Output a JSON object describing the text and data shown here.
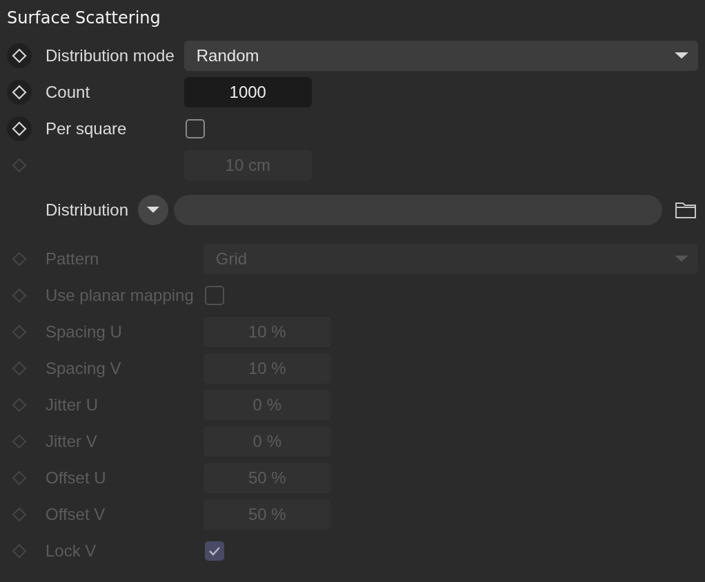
{
  "title": "Surface Scattering",
  "sections": [
    {
      "rows": [
        {
          "kind": "dropdown",
          "keyframe": true,
          "disabled": false,
          "label": "Distribution mode",
          "value": "Random"
        },
        {
          "kind": "number",
          "keyframe": true,
          "disabled": false,
          "label": "Count",
          "value": "1000"
        },
        {
          "kind": "checkbox",
          "keyframe": true,
          "disabled": false,
          "label": "Per square",
          "checked": false
        },
        {
          "kind": "number",
          "keyframe": true,
          "disabled": true,
          "value": "10 cm"
        }
      ]
    },
    {
      "rows": [
        {
          "kind": "link",
          "keyframe": false,
          "disabled": false,
          "label": "Distribution"
        }
      ]
    },
    {
      "rows": [
        {
          "kind": "dropdown",
          "keyframe": true,
          "disabled": true,
          "label": "Pattern",
          "value": "Grid"
        },
        {
          "kind": "checkbox",
          "keyframe": true,
          "disabled": true,
          "label": "Use planar mapping",
          "checked": false
        },
        {
          "kind": "number",
          "keyframe": true,
          "disabled": true,
          "label": "Spacing U",
          "value": "10 %"
        },
        {
          "kind": "number",
          "keyframe": true,
          "disabled": true,
          "label": "Spacing V",
          "value": "10 %"
        },
        {
          "kind": "number",
          "keyframe": true,
          "disabled": true,
          "label": "Jitter U",
          "value": "0 %"
        },
        {
          "kind": "number",
          "keyframe": true,
          "disabled": true,
          "label": "Jitter V",
          "value": "0 %"
        },
        {
          "kind": "number",
          "keyframe": true,
          "disabled": true,
          "label": "Offset U",
          "value": "50 %"
        },
        {
          "kind": "number",
          "keyframe": true,
          "disabled": true,
          "label": "Offset V",
          "value": "50 %"
        },
        {
          "kind": "checkbox",
          "keyframe": true,
          "disabled": true,
          "label": "Lock V",
          "checked": true
        }
      ]
    }
  ]
}
